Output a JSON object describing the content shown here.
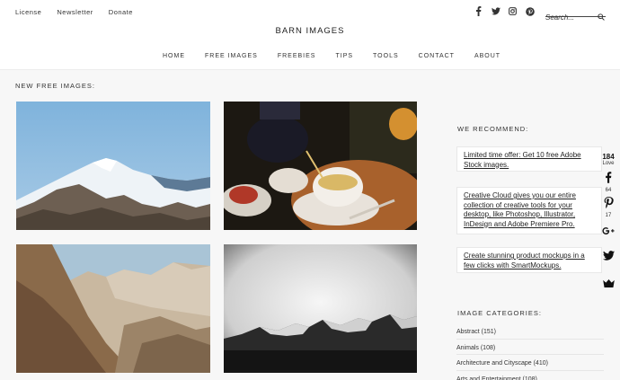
{
  "top_links": [
    "License",
    "Newsletter",
    "Donate"
  ],
  "social_icons": [
    "facebook-icon",
    "twitter-icon",
    "instagram-icon",
    "pinterest-icon"
  ],
  "search": {
    "placeholder": "Search..."
  },
  "brand": "BARN IMAGES",
  "nav": [
    "HOME",
    "FREE IMAGES",
    "FREEBIES",
    "TIPS",
    "TOOLS",
    "CONTACT",
    "ABOUT"
  ],
  "main": {
    "section_title": "NEW FREE IMAGES:",
    "photos": [
      "snowy-mountain-photo",
      "teapot-pouring-tea-photo",
      "rocky-valley-photo",
      "dark-mountain-range-photo"
    ]
  },
  "sidebar": {
    "recommend_title": "WE RECOMMEND:",
    "recommendations": [
      "Limited time offer: Get 10 free Adobe Stock images.",
      "Creative Cloud gives you our entire collection of creative tools for your desktop, like Photoshop, Illustrator, InDesign and Adobe Premiere Pro.",
      "Create stunning product mockups in a few clicks with SmartMockups."
    ],
    "categories_title": "IMAGE CATEGORIES:",
    "categories": [
      "Abstract (151)",
      "Animals (108)",
      "Architecture and Cityscape (410)",
      "Arts and Entertainment (108)"
    ]
  },
  "share": {
    "total": "184",
    "total_label": "Love",
    "facebook_count": "64",
    "pinterest_count": "17"
  },
  "colors": {
    "text": "#222222",
    "background": "#f7f7f7",
    "header": "#ffffff"
  }
}
